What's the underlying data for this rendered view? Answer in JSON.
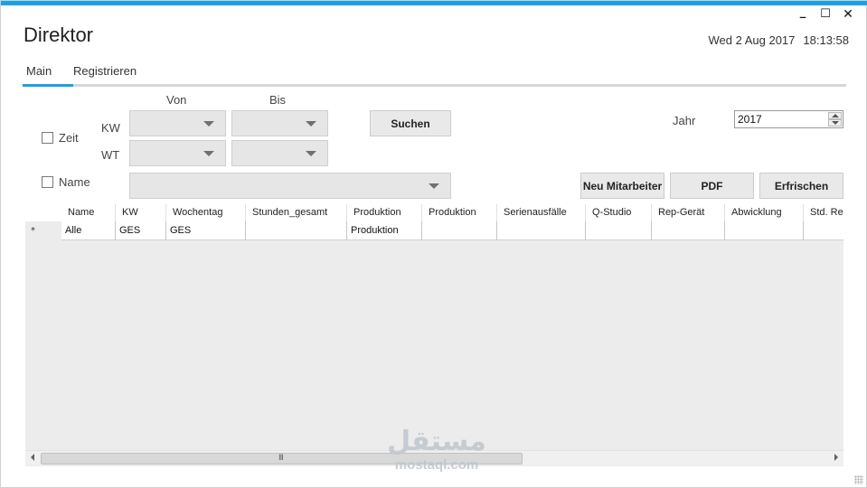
{
  "window": {
    "title": "Direktor",
    "date": "Wed 2 Aug 2017",
    "time": "18:13:58",
    "controls": {
      "minimize": "_",
      "maximize": "☐",
      "close": "✕"
    },
    "accent_color": "#1ba1e2"
  },
  "tabs": [
    {
      "label": "Main",
      "active": true
    },
    {
      "label": "Registrieren",
      "active": false
    }
  ],
  "filters": {
    "von_label": "Von",
    "bis_label": "Bis",
    "zeit_label": "Zeit",
    "kw_label": "KW",
    "wt_label": "WT",
    "name_label": "Name",
    "zeit_checked": false,
    "name_checked": false
  },
  "year": {
    "label": "Jahr",
    "value": "2017"
  },
  "buttons": {
    "suchen": "Suchen",
    "neu_mitarbeiter": "Neu Mitarbeiter",
    "pdf": "PDF",
    "erfrischen": "Erfrischen"
  },
  "table": {
    "columns": [
      "Name",
      "KW",
      "Wochentag",
      "Stunden_gesamt",
      "Produktion",
      "Produktion",
      "Serienausfälle",
      "Q-Studio",
      "Rep-Gerät",
      "Abwicklung",
      "Std. Re"
    ],
    "new_row_marker": "*",
    "rows": [
      [
        "Alle",
        "GES",
        "GES",
        "",
        "Produktion",
        "",
        "",
        "",
        "",
        "",
        ""
      ]
    ]
  },
  "scrollbar": {
    "grip": "III"
  },
  "watermark": {
    "logo": "مستقل",
    "text": "mostaql.com"
  }
}
